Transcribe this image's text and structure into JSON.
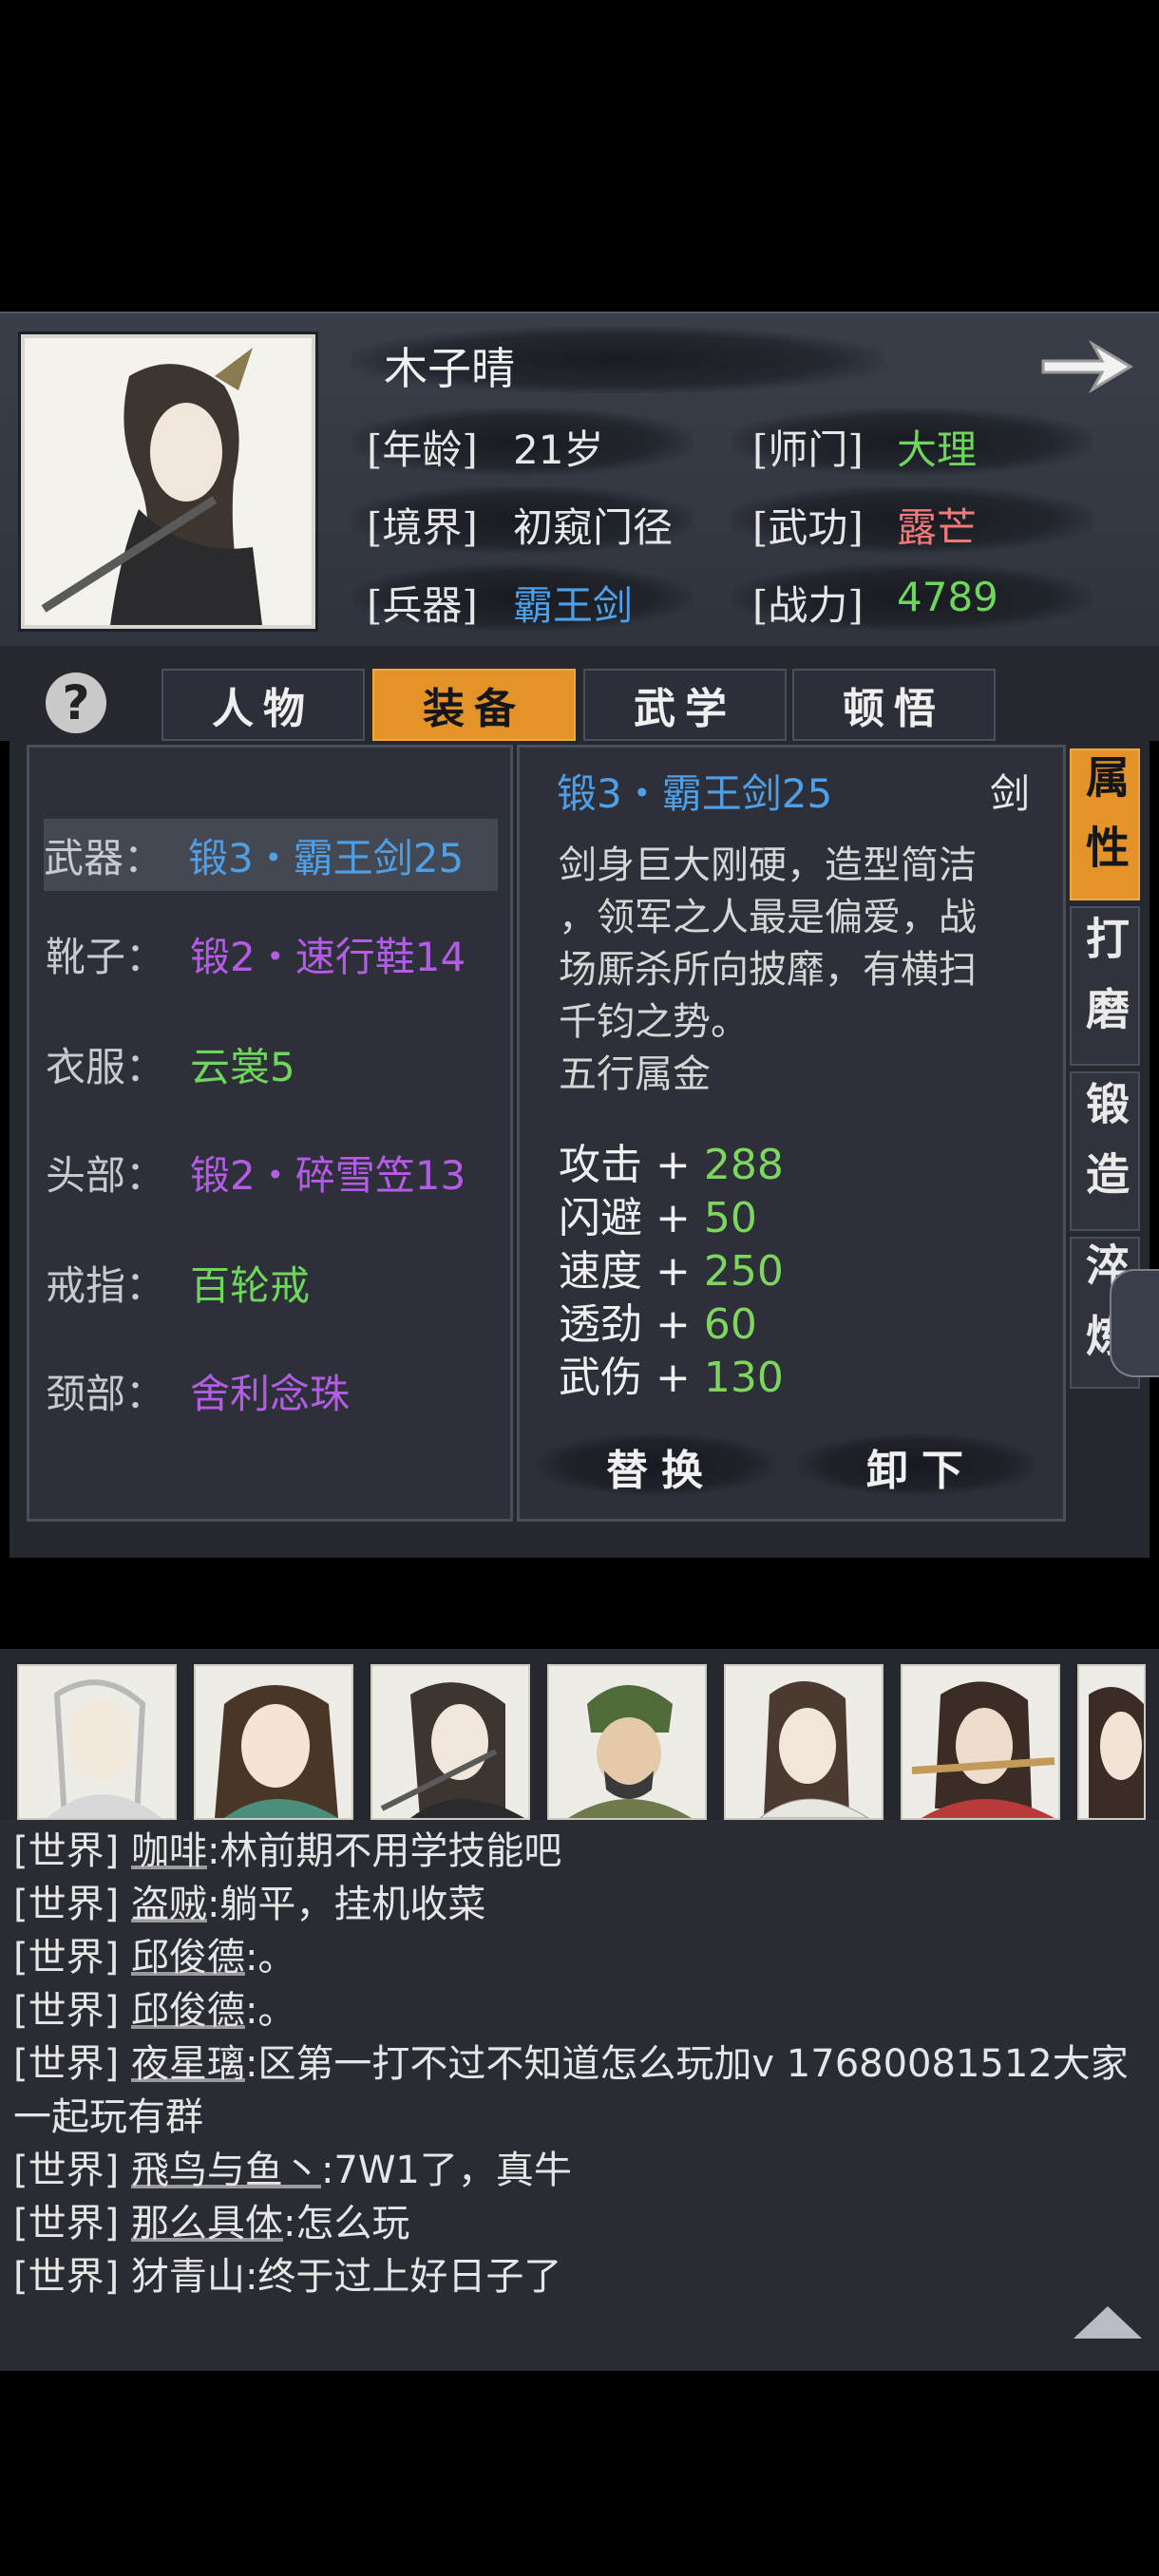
{
  "profile": {
    "name": "木子晴",
    "age_label": "[年龄]",
    "age_value": "21岁",
    "realm_label": "[境界]",
    "realm_value": "初窥门径",
    "weapon_label": "[兵器]",
    "weapon_value": "霸王剑",
    "sect_label": "[师门]",
    "sect_value": "大理",
    "martial_label": "[武功]",
    "martial_value": "露芒",
    "power_label": "[战力]",
    "power_value": "4789"
  },
  "tabs": [
    {
      "label": "人物"
    },
    {
      "label": "装备",
      "active": true
    },
    {
      "label": "武学"
    },
    {
      "label": "顿悟"
    }
  ],
  "help_label": "?",
  "equipment": [
    {
      "slot": "武器：",
      "item": "锻3・霸王剑25",
      "color": "#4f9fe6",
      "selected": true
    },
    {
      "slot": "靴子：",
      "item": "锻2・速行鞋14",
      "color": "#b45ce6"
    },
    {
      "slot": "衣服：",
      "item": "云裳5",
      "color": "#6ed65a"
    },
    {
      "slot": "头部：",
      "item": "锻2・碎雪笠13",
      "color": "#b45ce6"
    },
    {
      "slot": "戒指：",
      "item": "百轮戒",
      "color": "#6ed65a"
    },
    {
      "slot": "颈部：",
      "item": "舍利念珠",
      "color": "#b45ce6"
    }
  ],
  "detail": {
    "title": "锻3・霸王剑25",
    "type": "剑",
    "desc_lines": [
      "剑身巨大刚硬，造型简洁",
      "，领军之人最是偏爱，战",
      "场厮杀所向披靡，有横扫",
      "千钧之势。",
      "五行属金"
    ],
    "stats": [
      {
        "name": "攻击",
        "plus": "+",
        "value": "288"
      },
      {
        "name": "闪避",
        "plus": "+",
        "value": "50"
      },
      {
        "name": "速度",
        "plus": "+",
        "value": "250"
      },
      {
        "name": "透劲",
        "plus": "+",
        "value": "60"
      },
      {
        "name": "武伤",
        "plus": "+",
        "value": "130"
      }
    ],
    "replace_label": "替换",
    "remove_label": "卸下"
  },
  "side_tabs": [
    {
      "label": "属性",
      "active": true
    },
    {
      "label": "打磨"
    },
    {
      "label": "锻造"
    },
    {
      "label": "淬炼"
    }
  ],
  "chat": [
    {
      "channel": "[世界]",
      "user": "咖啡",
      "text": ":林前期不用学技能吧"
    },
    {
      "channel": "[世界]",
      "user": "盗贼",
      "text": ":躺平，挂机收菜"
    },
    {
      "channel": "[世界]",
      "user": "邱俊德",
      "text": ":。"
    },
    {
      "channel": "[世界]",
      "user": "邱俊德",
      "text": ":。"
    },
    {
      "channel": "[世界]",
      "user": "夜星璃",
      "text": ":区第一打不过不知道怎么玩加v 17680081512大家"
    },
    {
      "channel": "",
      "user": "",
      "text": "一起玩有群"
    },
    {
      "channel": "[世界]",
      "user": "飛鸟与鱼丶",
      "text": ":7W1了，真牛"
    },
    {
      "channel": "[世界]",
      "user": "那么具体",
      "text": ":怎么玩"
    },
    {
      "channel": "[世界]",
      "user": "犲青山",
      "text": ":终于过上好日子了"
    }
  ],
  "colors": {
    "accent_orange": "#e39327",
    "green": "#6ed65a",
    "blue": "#4f9fe6",
    "purple": "#b45ce6",
    "pink": "#f07a7a"
  }
}
